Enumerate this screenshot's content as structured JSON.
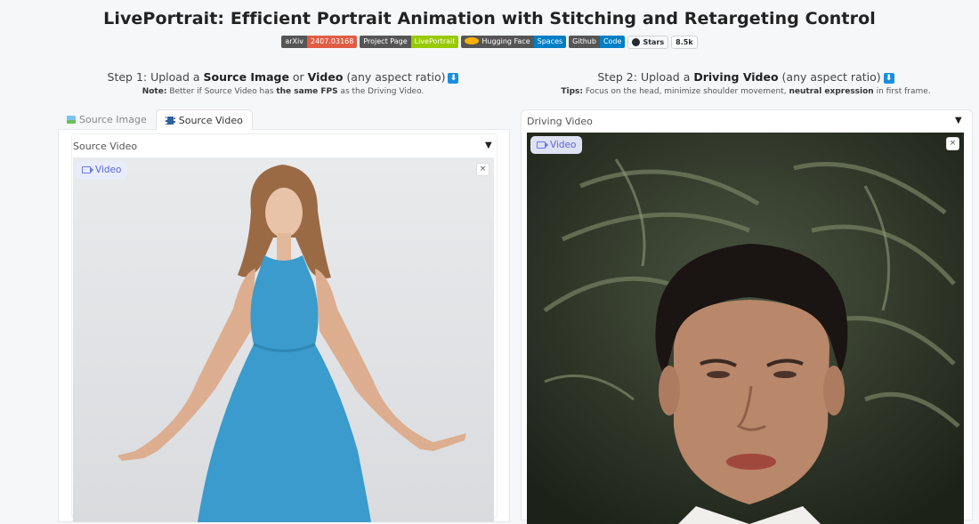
{
  "header": {
    "title": "LivePortrait: Efficient Portrait Animation with Stitching and Retargeting Control",
    "badges": [
      {
        "left": "arXiv",
        "right": "2407.03168",
        "color": "#e05d44"
      },
      {
        "left": "Project Page",
        "right": "LivePortrait",
        "color": "#97ca00"
      },
      {
        "left": "Hugging Face",
        "right": "Spaces",
        "color": "#007ec6"
      },
      {
        "left": "Github",
        "right": "Code",
        "color": "#007ec6"
      }
    ],
    "github_stars": {
      "label": "Stars",
      "count": "8.5k"
    }
  },
  "step1": {
    "prefix": "Step 1: Upload a ",
    "bold1": "Source Image",
    "mid": " or ",
    "bold2": "Video",
    "suffix": " (any aspect ratio)",
    "arrow": "⬇",
    "note_label": "Note:",
    "note_text1": " Better if Source Video has ",
    "note_bold": "the same FPS",
    "note_text2": " as the Driving Video."
  },
  "step2": {
    "prefix": "Step 2: Upload a ",
    "bold1": "Driving Video",
    "suffix": " (any aspect ratio)",
    "arrow": "⬇",
    "tips_label": "Tips:",
    "tips_text1": " Focus on the head, minimize shoulder movement, ",
    "tips_bold": "neutral expression",
    "tips_text2": " in first frame."
  },
  "tabs": [
    {
      "label": "Source Image",
      "active": false
    },
    {
      "label": "Source Video",
      "active": true
    }
  ],
  "source_video": {
    "label": "Source Video",
    "tag": "Video",
    "close": "×"
  },
  "driving_video": {
    "label": "Driving Video",
    "tag": "Video",
    "close": "×"
  },
  "colors": {
    "accent": "#5a66d6",
    "download_arrow": "#1a8ee0"
  }
}
